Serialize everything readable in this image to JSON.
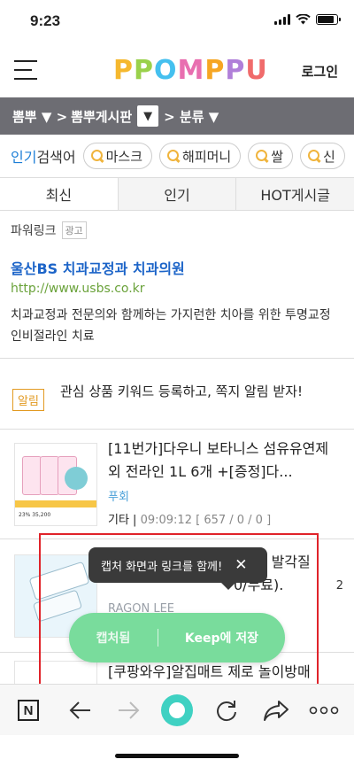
{
  "status": {
    "time": "9:23"
  },
  "header": {
    "logo_letters": [
      {
        "ch": "P",
        "color": "#f5b82e"
      },
      {
        "ch": "P",
        "color": "#9ad14b"
      },
      {
        "ch": "O",
        "color": "#45c0ef"
      },
      {
        "ch": "M",
        "color": "#e86fb0"
      },
      {
        "ch": "P",
        "color": "#f6a623"
      },
      {
        "ch": "P",
        "color": "#b07fd9"
      },
      {
        "ch": "U",
        "color": "#f06b6b"
      }
    ],
    "login_label": "로그인"
  },
  "breadcrumb": {
    "part1": "뽐뿌 ▼ >",
    "part2": "뽐뿌게시판",
    "dropdown": "▼",
    "part3": "> 분류 ▼"
  },
  "popular": {
    "label_highlight": "인기",
    "label_rest": "검색어",
    "chips": [
      "마스크",
      "해피머니",
      "쌀",
      "신"
    ]
  },
  "tabs": [
    "최신",
    "인기",
    "HOT게시글"
  ],
  "powerlink": {
    "label": "파워링크",
    "ad_badge": "광고",
    "title": "울산BS 치과교정과 치과의원",
    "url": "http://www.usbs.co.kr",
    "desc": "치과교정과 전문의와 함께하는 가지런한 치아를 위한 투명교정 인비절라인 치료"
  },
  "notice": {
    "badge": "알림",
    "text": "관심 상품 키워드 등록하고, 쪽지 알림 받자!"
  },
  "items": [
    {
      "title": "[11번가]다우니 보타니스 섬유유연제 외 전라인 1L 6개 +[증정]다...",
      "shop": "푸회",
      "category": "기타",
      "time": "09:09:12",
      "stats": "[ 657 / 0 / 0 ]",
      "thumb_price": "23% 35,200"
    },
    {
      "title": "[카카오톡 쇼핑]도도풋케어 발각질",
      "title_tail": "0/무료).",
      "shop": "RAGON LEE",
      "comment_count": "2"
    },
    {
      "title": "[쿠팡와우]알집매트 제로 놀이방매"
    }
  ],
  "tooltip": {
    "text": "캡처 화면과 링크를 함께!",
    "close": "✕"
  },
  "keep": {
    "capture_label": "캡처됨",
    "save_label_bold": "Keep",
    "save_label_rest": "에 저장"
  },
  "toolbar": {
    "n_label": "N"
  },
  "colors": {
    "accent_blue": "#1c64c8",
    "url_green": "#6aa23a",
    "keep_green": "#79dc9c",
    "highlight_red": "#e0232a",
    "breadcrumb_gray": "#6d6d73"
  }
}
